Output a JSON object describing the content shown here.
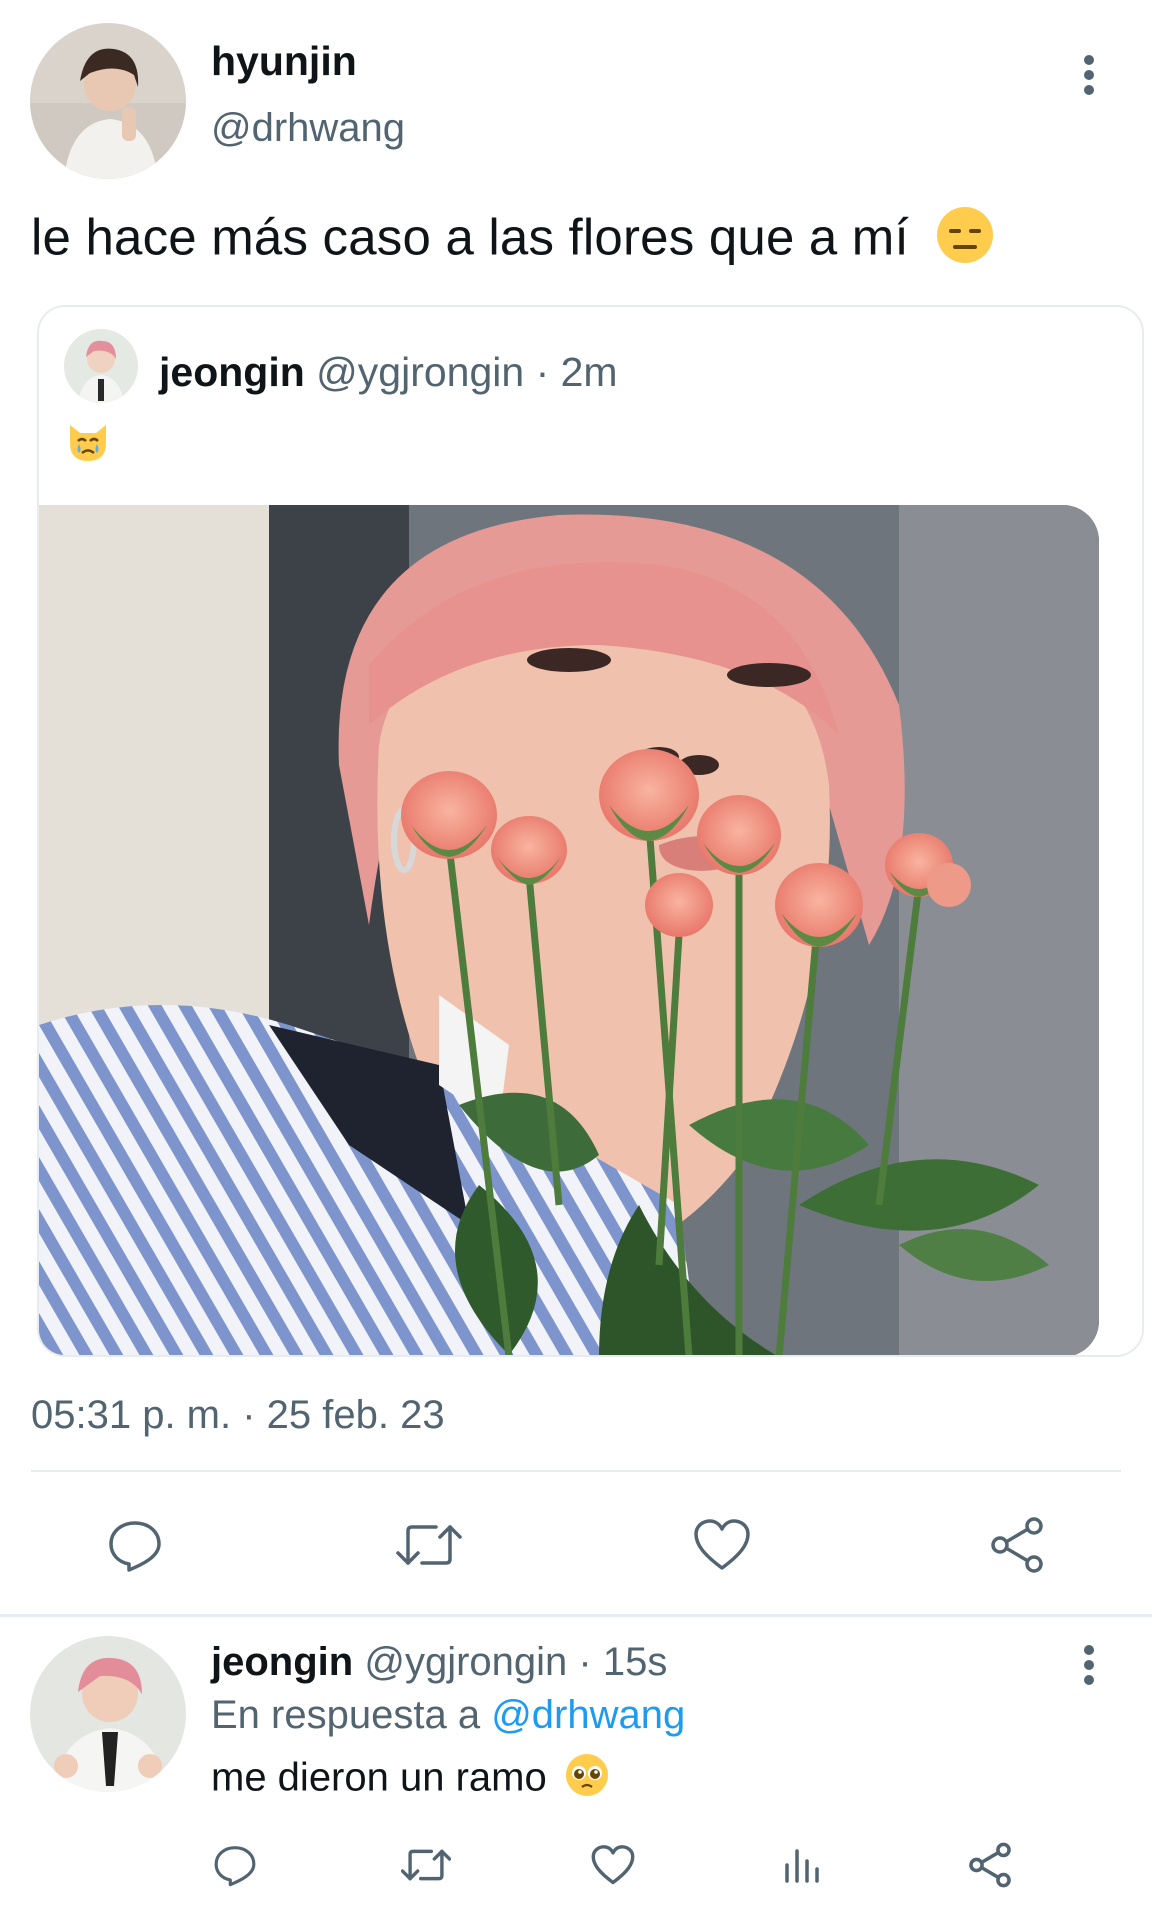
{
  "main_tweet": {
    "author_name": "hyunjin",
    "author_handle": "@drhwang",
    "text": "le hace más caso a las flores que a mí",
    "text_emoji": "expressionless-face-emoji",
    "timestamp": "05:31 p. m. · 25 feb. 23",
    "more_icon": "more-vertical-icon"
  },
  "quoted_tweet": {
    "author_name": "jeongin",
    "author_handle": "@ygjrongin",
    "time": " · 2m",
    "text_emoji": "crying-cat-emoji",
    "media": "photo-pink-hair-roses"
  },
  "actions": {
    "reply_icon": "reply-icon",
    "retweet_icon": "retweet-icon",
    "like_icon": "heart-icon",
    "share_icon": "share-icon"
  },
  "reply_tweet": {
    "author_name": "jeongin",
    "author_handle": "@ygjrongin",
    "time": " · 15s",
    "in_reply_prefix": "En respuesta a ",
    "in_reply_mention": "@drhwang",
    "text": "me dieron un ramo",
    "text_emoji": "pleading-face-emoji",
    "more_icon": "more-vertical-icon",
    "action_icons": [
      "reply-icon",
      "retweet-icon",
      "heart-icon",
      "analytics-icon",
      "share-icon"
    ]
  },
  "colors": {
    "text": "#0f1419",
    "secondary": "#536471",
    "link": "#1d9bf0",
    "divider": "#e6ecf0"
  }
}
